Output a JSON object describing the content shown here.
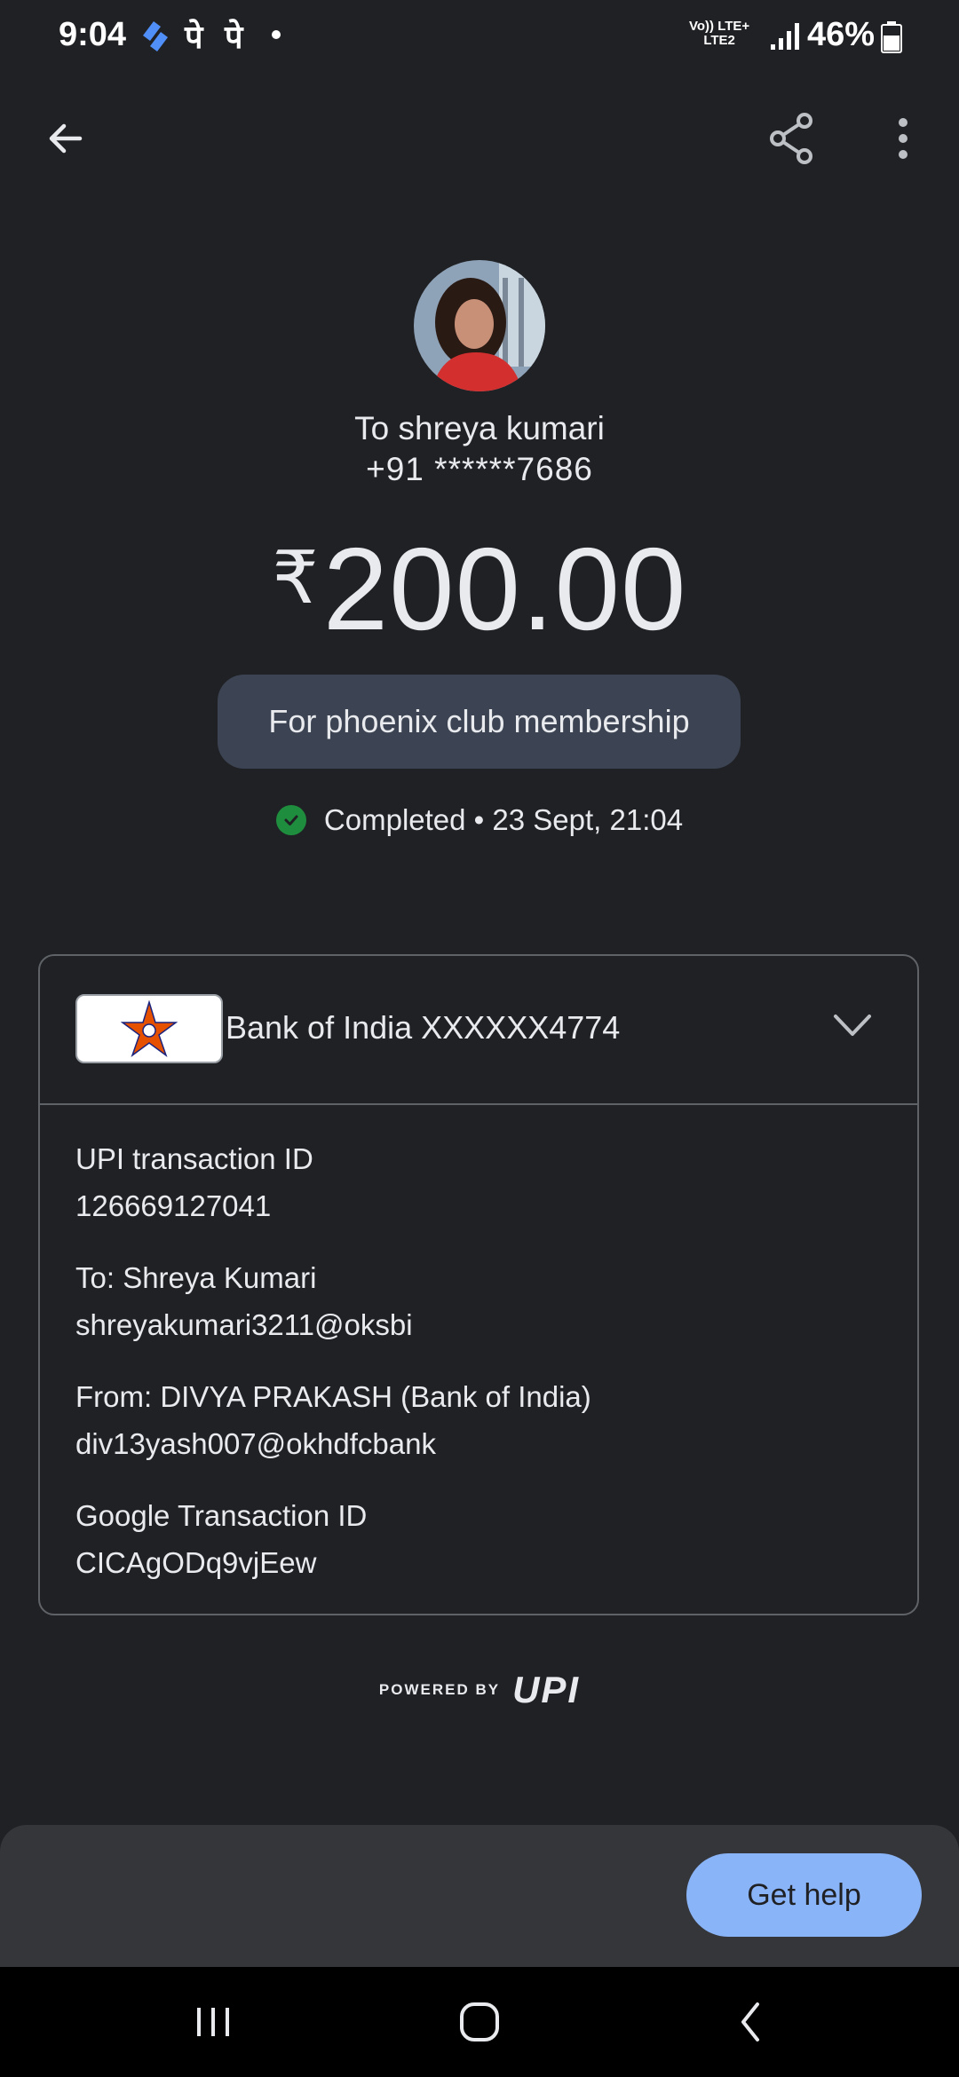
{
  "status_bar": {
    "time": "9:04",
    "app_text": "पे पे",
    "network_line1": "Vo)) LTE+",
    "network_line2": "LTE2",
    "battery": "46%"
  },
  "toolbar": {
    "back_icon": "arrow-back-icon",
    "share_icon": "share-icon",
    "more_icon": "more-vert-icon"
  },
  "payment": {
    "recipient": "To shreya kumari",
    "phone": "+91 ******7686",
    "currency": "₹",
    "amount": "200.00",
    "note": "For phoenix club membership",
    "status": "Completed • 23 Sept, 21:04"
  },
  "account": {
    "bank_name": "Bank of India XXXXXX4774"
  },
  "details": [
    {
      "label": "UPI transaction ID",
      "value": "126669127041"
    },
    {
      "label": "To: Shreya  Kumari",
      "value": "shreyakumari3211@oksbi"
    },
    {
      "label": "From: DIVYA PRAKASH (Bank of India)",
      "value": "div13yash007@okhdfcbank"
    },
    {
      "label": "Google Transaction ID",
      "value": "CICAgODq9vjEew"
    }
  ],
  "footer": {
    "powered_by": "POWERED BY",
    "upi": "UPI"
  },
  "help_button": "Get help",
  "colors": {
    "background": "#202124",
    "pill": "#3c4453",
    "success": "#1e8e3e",
    "button": "#8ab4f8"
  }
}
